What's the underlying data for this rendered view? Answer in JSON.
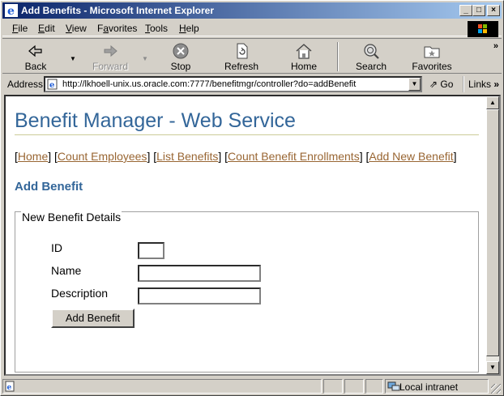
{
  "window": {
    "title": "Add Benefits - Microsoft Internet Explorer",
    "controls": [
      "_",
      "□",
      "×"
    ]
  },
  "menu": [
    {
      "key": "F",
      "rest": "ile"
    },
    {
      "key": "E",
      "rest": "dit"
    },
    {
      "key": "V",
      "rest": "iew"
    },
    {
      "key": "",
      "pre": "F",
      "key2": "a",
      "rest": "vorites"
    },
    {
      "key": "T",
      "rest": "ools"
    },
    {
      "key": "H",
      "rest": "elp"
    }
  ],
  "toolbar": {
    "back": "Back",
    "forward": "Forward",
    "stop": "Stop",
    "refresh": "Refresh",
    "home": "Home",
    "search": "Search",
    "favorites": "Favorites",
    "more": "»"
  },
  "address": {
    "label": "Address",
    "url": "http://lkhoell-unix.us.oracle.com:7777/benefitmgr/controller?do=addBenefit",
    "go": "Go",
    "links": "Links",
    "more": "»"
  },
  "page": {
    "title": "Benefit Manager - Web Service",
    "nav": [
      {
        "label": "Home"
      },
      {
        "label": "Count Employees"
      },
      {
        "label": "List Benefits"
      },
      {
        "label": "Count Benefit Enrollments"
      },
      {
        "label": "Add New Benefit"
      }
    ],
    "section_title": "Add Benefit",
    "form": {
      "legend": "New Benefit Details",
      "id_label": "ID",
      "id_value": "",
      "name_label": "Name",
      "name_value": "",
      "description_label": "Description",
      "description_value": "",
      "submit": "Add Benefit"
    }
  },
  "status": {
    "zone": "Local intranet"
  },
  "colors": {
    "heading": "#336699",
    "link": "#996633",
    "rule": "#cccc99",
    "titlebar_start": "#0a246a",
    "titlebar_end": "#a6caf0"
  }
}
